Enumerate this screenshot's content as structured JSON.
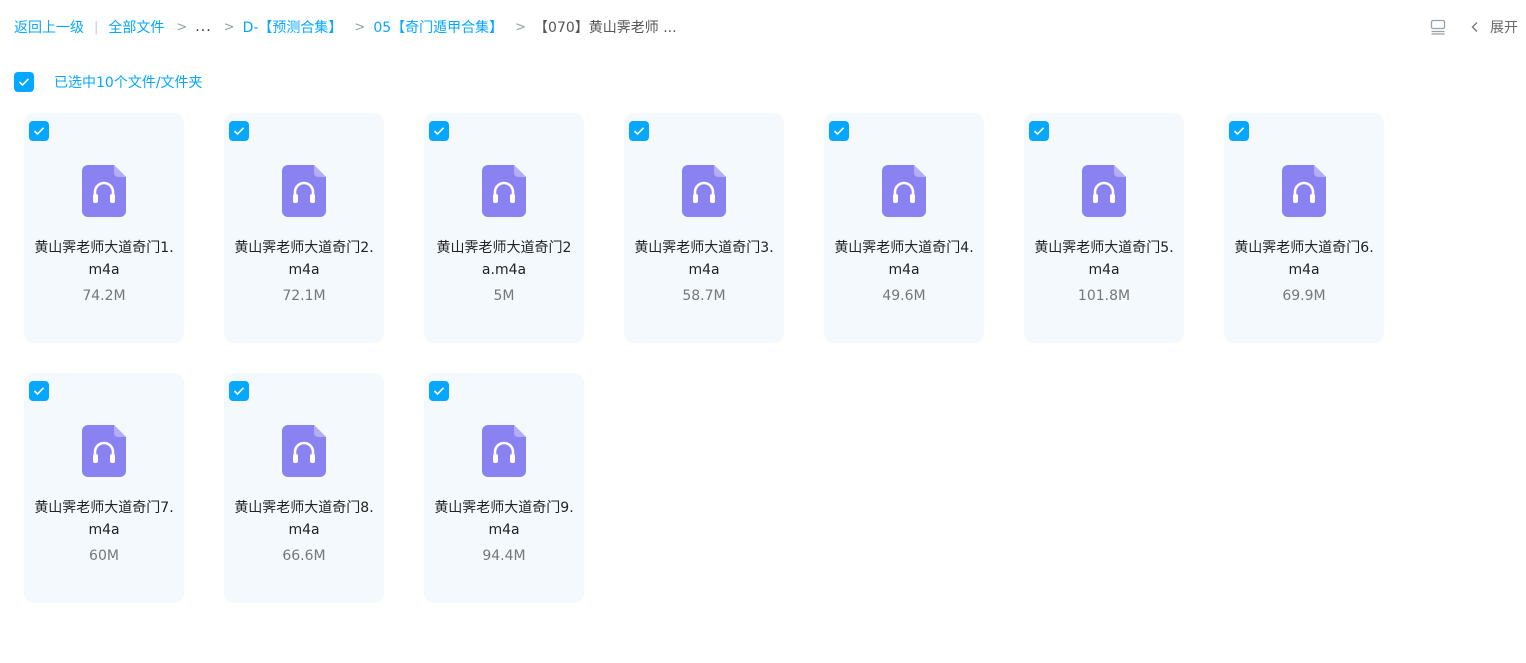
{
  "breadcrumb": {
    "back": "返回上一级",
    "all_files": "全部文件",
    "ellipsis": "...",
    "level1": "D-【预测合集】",
    "level2": "05【奇门遁甲合集】",
    "current": "【070】黄山霁老师 ..."
  },
  "toolbar": {
    "expand_label": "展开"
  },
  "selection": {
    "label": "已选中10个文件/文件夹"
  },
  "colors": {
    "accent": "#06a7ff",
    "card_bg": "#f3f9fd",
    "audio_icon": "#8a82f0"
  },
  "files": [
    {
      "name": "黄山霁老师大道奇门1.m4a",
      "size": "74.2M",
      "icon": "audio-file-icon",
      "checked": true
    },
    {
      "name": "黄山霁老师大道奇门2.m4a",
      "size": "72.1M",
      "icon": "audio-file-icon",
      "checked": true
    },
    {
      "name": "黄山霁老师大道奇门2a.m4a",
      "size": "5M",
      "icon": "audio-file-icon",
      "checked": true
    },
    {
      "name": "黄山霁老师大道奇门3.m4a",
      "size": "58.7M",
      "icon": "audio-file-icon",
      "checked": true
    },
    {
      "name": "黄山霁老师大道奇门4.m4a",
      "size": "49.6M",
      "icon": "audio-file-icon",
      "checked": true
    },
    {
      "name": "黄山霁老师大道奇门5.m4a",
      "size": "101.8M",
      "icon": "audio-file-icon",
      "checked": true
    },
    {
      "name": "黄山霁老师大道奇门6.m4a",
      "size": "69.9M",
      "icon": "audio-file-icon",
      "checked": true
    },
    {
      "name": "黄山霁老师大道奇门7.m4a",
      "size": "60M",
      "icon": "audio-file-icon",
      "checked": true
    },
    {
      "name": "黄山霁老师大道奇门8.m4a",
      "size": "66.6M",
      "icon": "audio-file-icon",
      "checked": true
    },
    {
      "name": "黄山霁老师大道奇门9.m4a",
      "size": "94.4M",
      "icon": "audio-file-icon",
      "checked": true
    }
  ]
}
